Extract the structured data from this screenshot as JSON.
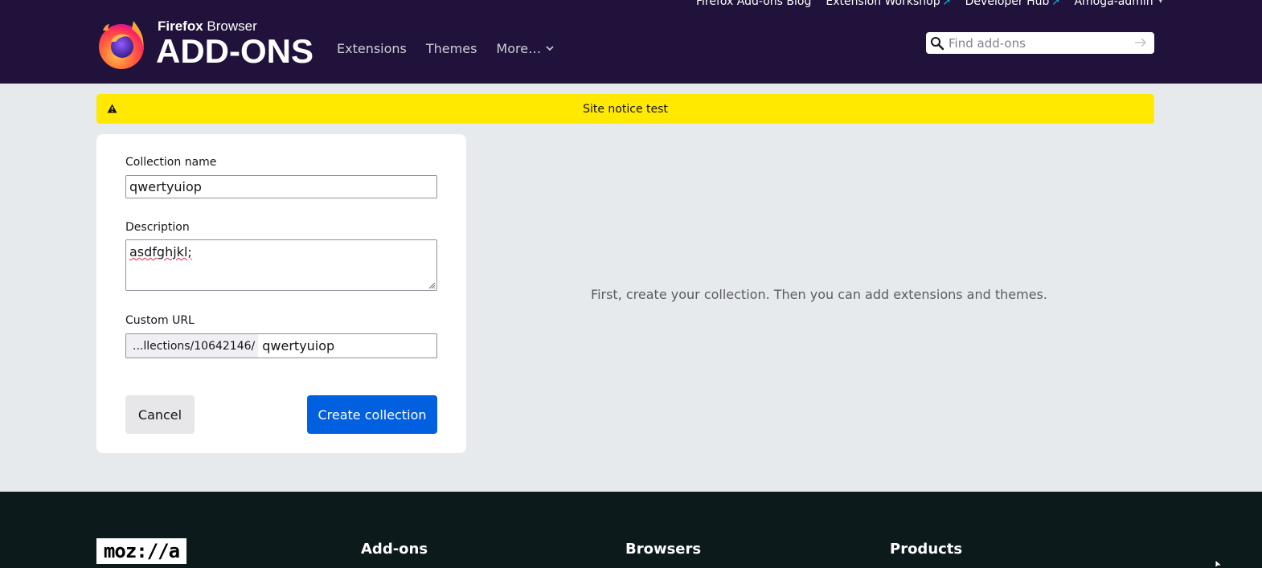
{
  "header": {
    "top_links": [
      {
        "label": "Firefox Add-ons Blog",
        "external": false
      },
      {
        "label": "Extension Workshop",
        "external": true
      },
      {
        "label": "Developer Hub",
        "external": true
      },
      {
        "label": "Amoga-admin",
        "dropdown": true
      }
    ],
    "logo": {
      "small_regular": "Firefox",
      "small_light": "Browser",
      "big": "ADD-ONS"
    },
    "nav": {
      "extensions": "Extensions",
      "themes": "Themes",
      "more": "More…"
    },
    "search": {
      "placeholder": "Find add-ons",
      "value": ""
    }
  },
  "notice": {
    "text": "Site notice test",
    "icon": "warning-icon"
  },
  "form": {
    "name_label": "Collection name",
    "name_value": "qwertyuiop",
    "description_label": "Description",
    "description_value": "asdfghjkl;",
    "url_label": "Custom URL",
    "url_prefix": "...llections/10642146/",
    "url_value": "qwertyuiop",
    "cancel_label": "Cancel",
    "create_label": "Create collection"
  },
  "hint": "First, create your collection. Then you can add extensions and themes.",
  "footer": {
    "logo_text": "moz://a",
    "columns": [
      "Add-ons",
      "Browsers",
      "Products"
    ]
  },
  "colors": {
    "header_bg": "#20123a",
    "notice_bg": "#ffe900",
    "primary_button": "#0060df",
    "footer_bg": "#0c1a1c"
  }
}
